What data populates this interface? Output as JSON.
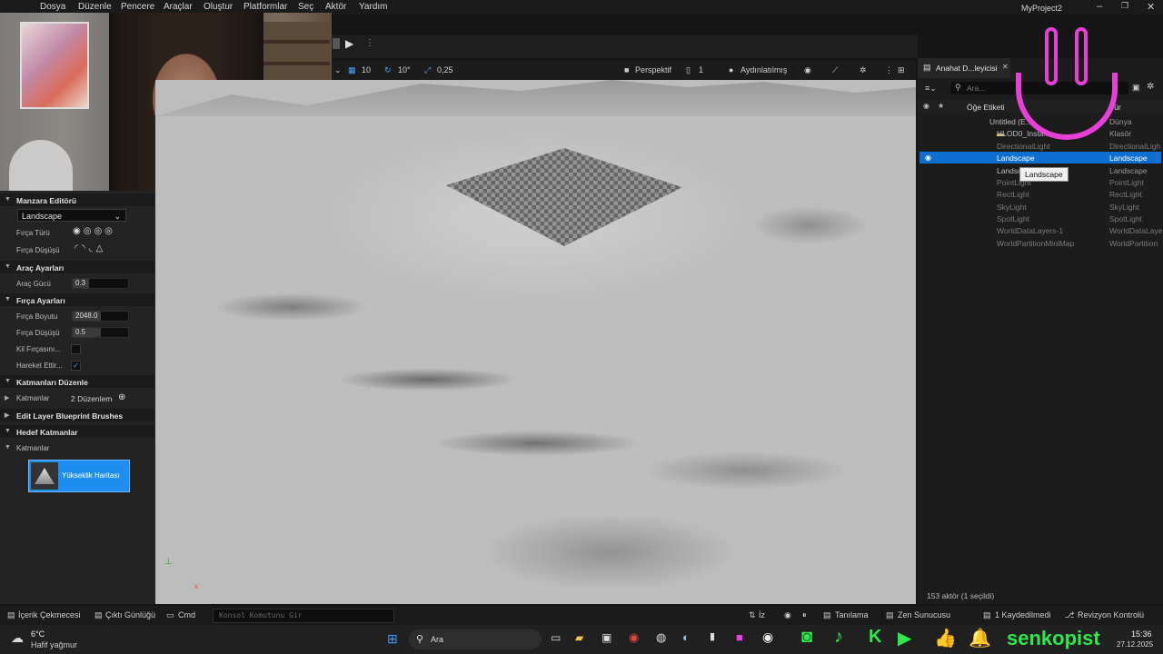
{
  "menu": [
    "Dosya",
    "Düzenle",
    "Pencere",
    "Araçlar",
    "Oluştur",
    "Platformlar",
    "Seç",
    "Aktör",
    "Yardım"
  ],
  "project_name": "MyProject2",
  "viewport_toolbar": {
    "grid_snap": "10",
    "rotation_snap": "10°",
    "scale_snap": "0,25",
    "perspective": "Perspektif",
    "camera_speed": "1",
    "lit_mode": "Aydınlatılmış"
  },
  "left_panel": {
    "title": "Manzara Editörü",
    "mode_select": "Landscape",
    "brush_type_label": "Fırça Türü",
    "brush_falloff_label": "Fırça Düşüşü",
    "tool_settings_title": "Araç Ayarları",
    "tool_strength_label": "Araç Gücü",
    "tool_strength_value": "0.3",
    "tool_strength_fraction": 0.3,
    "brush_settings_title": "Fırça Ayarları",
    "brush_size_label": "Fırça Boyutu",
    "brush_size_value": "2048.0",
    "brush_size_fraction": 0.5,
    "brush_falloff2_label": "Fırça Düşüşü",
    "brush_falloff_value": "0.5",
    "brush_falloff_fraction": 0.5,
    "clay_brush_label": "Kil Fırçasını...",
    "clay_brush_checked": false,
    "move_label": "Hareket Ettir...",
    "move_checked": true,
    "edit_layers_title": "Katmanları Düzenle",
    "layers_label": "Katmanlar",
    "layers_value": "2 Düzenleme",
    "edit_layer_bp_title": "Edit Layer Blueprint Brushes",
    "target_layers_title": "Hedef Katmanlar",
    "target_layers_label": "Katmanlar",
    "heightmap_label": "Yükseklik Haritası"
  },
  "outliner": {
    "tab_title": "Anahat D...leyicisi",
    "search_placeholder": "Ara...",
    "col_label": "Öğe Etiketi",
    "col_type": "Tür",
    "rows": [
      {
        "name": "Untitled (E...",
        "type": "Dünya"
      },
      {
        "name": "HLOD0_Insta...",
        "type": "Klasör"
      },
      {
        "name": "DirectionalLight",
        "type": "DirectionalLigh"
      },
      {
        "name": "Landscape",
        "type": "Landscape"
      },
      {
        "name": "Landscape",
        "type": "Landscape"
      },
      {
        "name": "PointLight",
        "type": "PointLight"
      },
      {
        "name": "RectLight",
        "type": "RectLight"
      },
      {
        "name": "SkyLight",
        "type": "SkyLight"
      },
      {
        "name": "SpotLight",
        "type": "SpotLight"
      },
      {
        "name": "WorldDataLayers-1",
        "type": "WorldDataLaye"
      },
      {
        "name": "WorldPartitionMiniMap",
        "type": "WorldPartition"
      }
    ],
    "tooltip": "Landscape",
    "footer": "153 aktör (1 seçildi)"
  },
  "statusbar": {
    "content_drawer": "İçerik Çekmecesi",
    "output_log": "Çıktı Günlüğü",
    "cmd": "Cmd",
    "console_placeholder": "Konsol Komutunu Gir",
    "trace": "İz",
    "derived": "Tanılama",
    "zen": "Zen Sunucusu",
    "unsaved": "1 Kaydedilmedi",
    "revision": "Revizyon Kontrolü"
  },
  "taskbar": {
    "temp": "6°C",
    "weather": "Hafif yağmur",
    "search": "Ara",
    "time": "15:36",
    "date": "27.12.2025",
    "streamer": "senkopist"
  },
  "colors": {
    "accent": "#1e8ff0",
    "selection": "#0f6fd1",
    "overlay_pink": "#e83fd6",
    "overlay_green": "#2ee84e"
  }
}
